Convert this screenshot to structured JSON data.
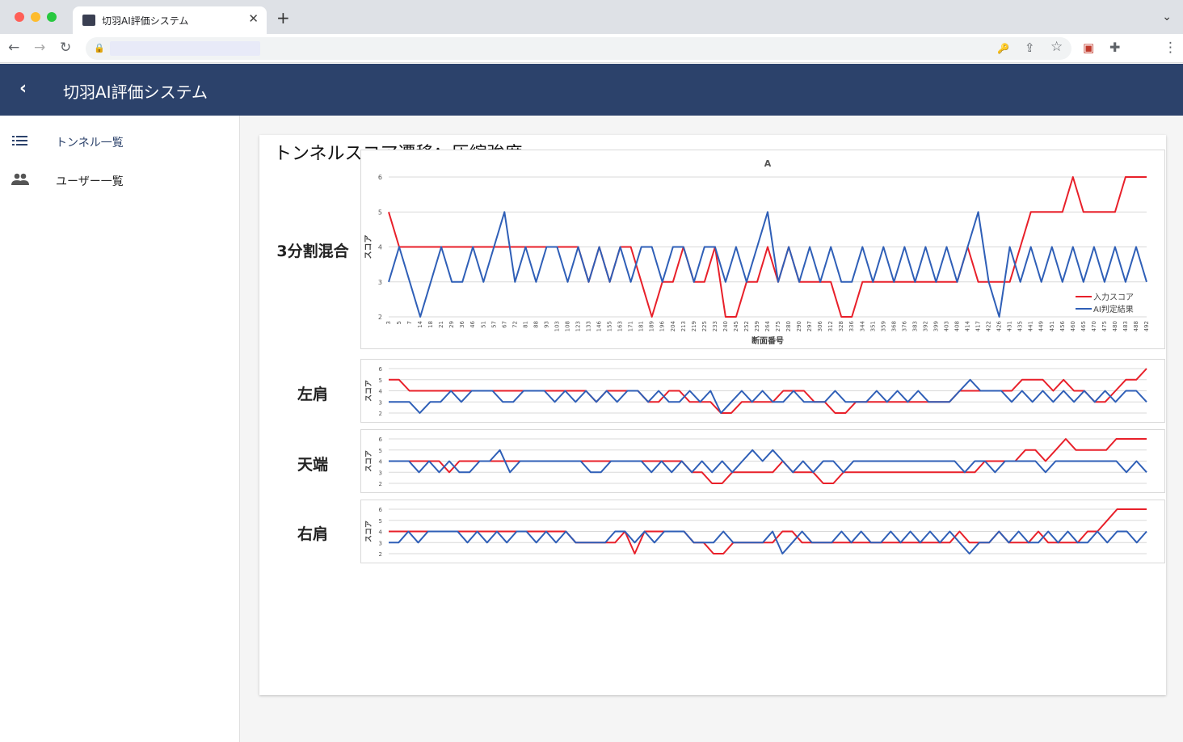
{
  "browser": {
    "tab_title": "切羽AI評価システム",
    "close_glyph": "✕",
    "new_tab_glyph": "+",
    "tab_menu_glyph": "⌄",
    "back_glyph": "←",
    "forward_glyph": "→",
    "reload_glyph": "↻",
    "lock_glyph": "🔒",
    "key_glyph": "🔑",
    "share_glyph": "⇪",
    "star_glyph": "☆",
    "cast_glyph": "▣",
    "extension_glyph": "✚",
    "menu_glyph": "⋮"
  },
  "appbar": {
    "back_glyph": "‹",
    "title": "切羽AI評価システム"
  },
  "sidebar": {
    "items": [
      {
        "label": "トンネル一覧",
        "icon": "list-icon",
        "active": true
      },
      {
        "label": "ユーザー一覧",
        "icon": "people-icon",
        "active": false
      }
    ]
  },
  "main": {
    "title": "トンネルスコア遷移：圧縮強度",
    "rows": [
      {
        "label": "3分割混合"
      },
      {
        "label": "左肩"
      },
      {
        "label": "天端"
      },
      {
        "label": "右肩"
      }
    ]
  },
  "colors": {
    "input": "#e8202a",
    "ai": "#2f5fb7",
    "appbar": "#2c426b",
    "accent": "#2c426b"
  },
  "chart_data": [
    {
      "type": "line",
      "panel": "3分割混合",
      "title": "A",
      "xlabel": "断面番号",
      "ylabel": "スコア",
      "ylim": [
        2,
        6
      ],
      "yticks": [
        2,
        3,
        4,
        5,
        6
      ],
      "xticks": [
        "3",
        "5",
        "7",
        "14",
        "18",
        "21",
        "29",
        "36",
        "46",
        "51",
        "57",
        "67",
        "72",
        "81",
        "88",
        "93",
        "103",
        "108",
        "123",
        "133",
        "146",
        "155",
        "163",
        "171",
        "181",
        "189",
        "196",
        "204",
        "213",
        "219",
        "225",
        "233",
        "240",
        "245",
        "252",
        "259",
        "264",
        "275",
        "280",
        "290",
        "297",
        "306",
        "312",
        "328",
        "336",
        "344",
        "351",
        "359",
        "368",
        "376",
        "383",
        "392",
        "399",
        "403",
        "408",
        "414",
        "417",
        "422",
        "426",
        "431",
        "435",
        "441",
        "449",
        "451",
        "456",
        "460",
        "465",
        "470",
        "475",
        "480",
        "483",
        "488",
        "492"
      ],
      "legend": [
        "入力スコア",
        "AI判定結果"
      ],
      "legend_position": "bottom-right",
      "series": [
        {
          "name": "入力スコア",
          "values": [
            5,
            4,
            4,
            4,
            4,
            4,
            4,
            4,
            4,
            4,
            4,
            4,
            4,
            4,
            4,
            4,
            4,
            4,
            4,
            3,
            4,
            3,
            4,
            4,
            3,
            2,
            3,
            3,
            4,
            3,
            3,
            4,
            2,
            2,
            3,
            3,
            4,
            3,
            4,
            3,
            3,
            3,
            3,
            2,
            2,
            3,
            3,
            3,
            3,
            3,
            3,
            3,
            3,
            3,
            3,
            4,
            3,
            3,
            3,
            3,
            4,
            5,
            5,
            5,
            5,
            6,
            5,
            5,
            5,
            5,
            6,
            6,
            6
          ]
        },
        {
          "name": "AI判定結果",
          "values": [
            3,
            4,
            3,
            2,
            3,
            4,
            3,
            3,
            4,
            3,
            4,
            5,
            3,
            4,
            3,
            4,
            4,
            3,
            4,
            3,
            4,
            3,
            4,
            3,
            4,
            4,
            3,
            4,
            4,
            3,
            4,
            4,
            3,
            4,
            3,
            4,
            5,
            3,
            4,
            3,
            4,
            3,
            4,
            3,
            3,
            4,
            3,
            4,
            3,
            4,
            3,
            4,
            3,
            4,
            3,
            4,
            5,
            3,
            2,
            4,
            3,
            4,
            3,
            4,
            3,
            4,
            3,
            4,
            3,
            4,
            3,
            4,
            3
          ]
        }
      ]
    },
    {
      "type": "line",
      "panel": "左肩",
      "ylabel": "スコア",
      "ylim": [
        2,
        6
      ],
      "yticks": [
        2,
        3,
        4,
        5,
        6
      ],
      "series": [
        {
          "name": "入力スコア",
          "values": [
            5,
            5,
            4,
            4,
            4,
            4,
            4,
            4,
            4,
            4,
            4,
            4,
            4,
            4,
            4,
            4,
            4,
            4,
            4,
            4,
            3,
            4,
            4,
            4,
            4,
            3,
            3,
            4,
            4,
            3,
            3,
            3,
            2,
            2,
            3,
            3,
            3,
            3,
            4,
            4,
            4,
            3,
            3,
            2,
            2,
            3,
            3,
            3,
            3,
            3,
            3,
            3,
            3,
            3,
            3,
            4,
            4,
            4,
            4,
            4,
            4,
            5,
            5,
            5,
            4,
            5,
            4,
            4,
            3,
            3,
            4,
            5,
            5,
            6
          ]
        },
        {
          "name": "AI判定結果",
          "values": [
            3,
            3,
            3,
            2,
            3,
            3,
            4,
            3,
            4,
            4,
            4,
            3,
            3,
            4,
            4,
            4,
            3,
            4,
            3,
            4,
            3,
            4,
            3,
            4,
            4,
            3,
            4,
            3,
            3,
            4,
            3,
            4,
            2,
            3,
            4,
            3,
            4,
            3,
            3,
            4,
            3,
            3,
            3,
            4,
            3,
            3,
            3,
            4,
            3,
            4,
            3,
            4,
            3,
            3,
            3,
            4,
            5,
            4,
            4,
            4,
            3,
            4,
            3,
            4,
            3,
            4,
            3,
            4,
            3,
            4,
            3,
            4,
            4,
            3
          ]
        }
      ]
    },
    {
      "type": "line",
      "panel": "天端",
      "ylabel": "スコア",
      "ylim": [
        2,
        6
      ],
      "yticks": [
        2,
        3,
        4,
        5,
        6
      ],
      "series": [
        {
          "name": "入力スコア",
          "values": [
            4,
            4,
            4,
            4,
            4,
            4,
            3,
            4,
            4,
            4,
            4,
            4,
            4,
            4,
            4,
            4,
            4,
            4,
            4,
            4,
            4,
            4,
            4,
            4,
            4,
            4,
            4,
            4,
            4,
            4,
            3,
            3,
            2,
            2,
            3,
            3,
            3,
            3,
            3,
            4,
            3,
            3,
            3,
            2,
            2,
            3,
            3,
            3,
            3,
            3,
            3,
            3,
            3,
            3,
            3,
            3,
            3,
            3,
            3,
            4,
            4,
            4,
            4,
            5,
            5,
            4,
            5,
            6,
            5,
            5,
            5,
            5,
            6,
            6,
            6,
            6
          ]
        },
        {
          "name": "AI判定結果",
          "values": [
            4,
            4,
            4,
            3,
            4,
            3,
            4,
            3,
            3,
            4,
            4,
            5,
            3,
            4,
            4,
            4,
            4,
            4,
            4,
            4,
            3,
            3,
            4,
            4,
            4,
            4,
            3,
            4,
            3,
            4,
            3,
            4,
            3,
            4,
            3,
            4,
            5,
            4,
            5,
            4,
            3,
            4,
            3,
            4,
            4,
            3,
            4,
            4,
            4,
            4,
            4,
            4,
            4,
            4,
            4,
            4,
            4,
            3,
            4,
            4,
            3,
            4,
            4,
            4,
            4,
            3,
            4,
            4,
            4,
            4,
            4,
            4,
            4,
            3,
            4,
            3
          ]
        }
      ]
    },
    {
      "type": "line",
      "panel": "右肩",
      "ylabel": "スコア",
      "ylim": [
        2,
        6
      ],
      "yticks": [
        2,
        3,
        4,
        5,
        6
      ],
      "series": [
        {
          "name": "入力スコア",
          "values": [
            4,
            4,
            4,
            4,
            4,
            4,
            4,
            4,
            4,
            4,
            4,
            4,
            4,
            4,
            4,
            4,
            4,
            4,
            4,
            3,
            3,
            3,
            3,
            3,
            4,
            2,
            4,
            4,
            4,
            4,
            4,
            3,
            3,
            2,
            2,
            3,
            3,
            3,
            3,
            3,
            4,
            4,
            3,
            3,
            3,
            3,
            3,
            3,
            3,
            3,
            3,
            3,
            3,
            3,
            3,
            3,
            3,
            3,
            4,
            3,
            3,
            3,
            4,
            3,
            3,
            3,
            4,
            3,
            3,
            3,
            3,
            4,
            4,
            5,
            6,
            6,
            6,
            6
          ]
        },
        {
          "name": "AI判定結果",
          "values": [
            3,
            3,
            4,
            3,
            4,
            4,
            4,
            4,
            3,
            4,
            3,
            4,
            3,
            4,
            4,
            3,
            4,
            3,
            4,
            3,
            3,
            3,
            3,
            4,
            4,
            3,
            4,
            3,
            4,
            4,
            4,
            3,
            3,
            3,
            4,
            3,
            3,
            3,
            3,
            4,
            2,
            3,
            4,
            3,
            3,
            3,
            4,
            3,
            4,
            3,
            3,
            4,
            3,
            4,
            3,
            4,
            3,
            4,
            3,
            2,
            3,
            3,
            4,
            3,
            4,
            3,
            3,
            4,
            3,
            4,
            3,
            3,
            4,
            3,
            4,
            4,
            3,
            4
          ]
        }
      ]
    }
  ]
}
